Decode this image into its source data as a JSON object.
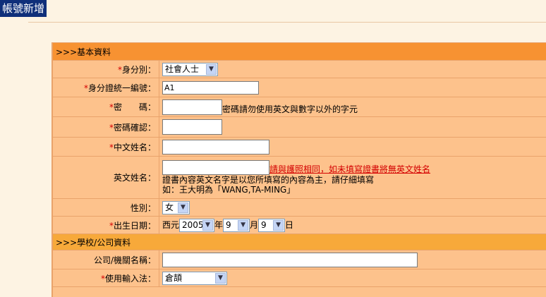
{
  "page": {
    "title": "帳號新增"
  },
  "sections": {
    "basic": ">>>基本資料",
    "school": ">>>學校/公司資料"
  },
  "fields": {
    "identity": {
      "label": "身分別：",
      "value": "社會人士"
    },
    "id_number": {
      "label": "身分證統一編號：",
      "value": "A1"
    },
    "password": {
      "label": "密　　碼：",
      "hint": "密碼請勿使用英文與數字以外的字元"
    },
    "password_confirm": {
      "label": "密碼確認："
    },
    "chinese_name": {
      "label": "中文姓名："
    },
    "english_name": {
      "label": "英文姓名：",
      "warning": "請與護照相同，如未填寫證書將無英文姓名",
      "note1": "證書內容英文名字是以您所填寫的內容為主，請仔細填寫",
      "note2": "如：王大明為「WANG,TA-MING」"
    },
    "gender": {
      "label": "性別：",
      "value": "女"
    },
    "birthday": {
      "label": "出生日期：",
      "era": "西元",
      "year": "2005",
      "year_unit": "年",
      "month": "9",
      "month_unit": "月",
      "day": "9",
      "day_unit": "日"
    },
    "company": {
      "label": "公司/機關名稱："
    },
    "input_method": {
      "label": "使用輸入法：",
      "value": "倉頡"
    }
  },
  "colors": {
    "section": "#f79232",
    "row": "#fdc28c",
    "title_bg": "#0f2f7a",
    "required": "#d40000"
  }
}
